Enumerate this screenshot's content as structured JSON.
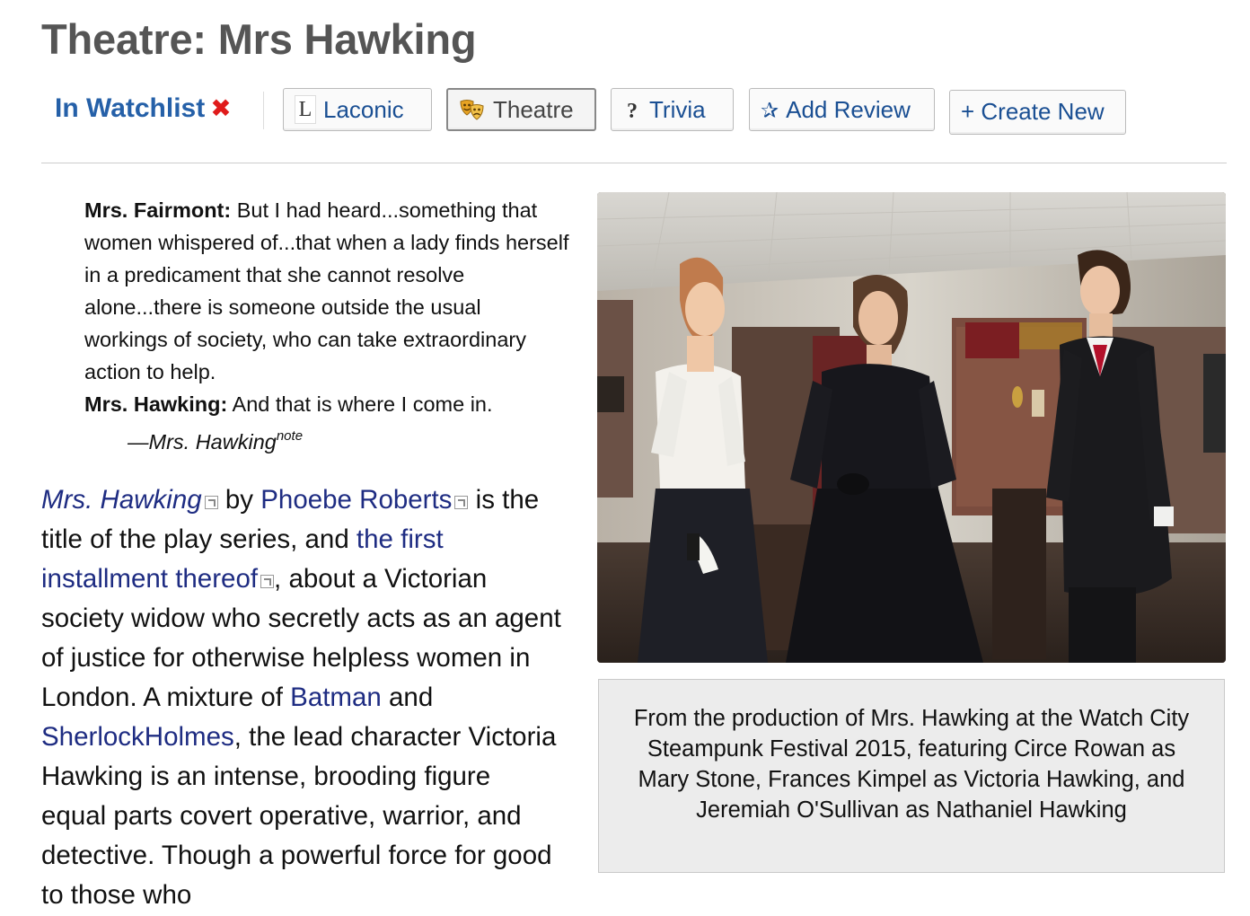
{
  "page": {
    "title": "Theatre: Mrs Hawking"
  },
  "toolbar": {
    "watchlist_label": "In Watchlist",
    "watchlist_remove_glyph": "✖",
    "buttons": [
      {
        "label": "Laconic",
        "icon": "laconic-icon",
        "glyph": "L"
      },
      {
        "label": "Theatre",
        "icon": "theatre-masks-icon",
        "active": true
      },
      {
        "label": "Trivia",
        "icon": "trivia-icon",
        "glyph": "?"
      },
      {
        "label": "Add Review",
        "icon": "star-icon",
        "glyph": "✰"
      },
      {
        "label": "+ Create New",
        "icon": ""
      }
    ]
  },
  "quote": {
    "speaker1": "Mrs. Fairmont:",
    "line1": " But I had heard...something that women whispered of...that when a lady finds herself in a predicament that she cannot resolve alone...there is someone outside the usual workings of society, who can take extraordinary action to help.",
    "speaker2": "Mrs. Hawking:",
    "line2": " And that is where I come in.",
    "attribution": "—Mrs. Hawking",
    "note": "note"
  },
  "article": {
    "link_title": "Mrs. Hawking",
    "t1": " by ",
    "link_author": "Phoebe Roberts",
    "t2": " is the title of the play series, and ",
    "link_first": "the first installment thereof",
    "t3": ", about a Victorian society widow who secretly acts as an agent of justice for otherwise helpless women in London. A mixture of ",
    "link_batman": "Batman",
    "t4": " and ",
    "link_sherlock": "SherlockHolmes",
    "t5": ", the lead character Victoria Hawking is an intense, brooding figure equal parts covert operative, warrior, and detective. Though a powerful force for good to those who"
  },
  "figure": {
    "caption": "From the production of Mrs. Hawking at the Watch City Steampunk Festival 2015, featuring Circe Rowan as Mary Stone, Frances Kimpel as Victoria Hawking, and Jeremiah O'Sullivan as Nathaniel Hawking"
  },
  "colors": {
    "title": "#555555",
    "watchlist": "#2560a8",
    "remove": "#e01b1b",
    "link": "#1e2c82",
    "button_text": "#1a4f93",
    "caption_bg": "#ececec"
  }
}
